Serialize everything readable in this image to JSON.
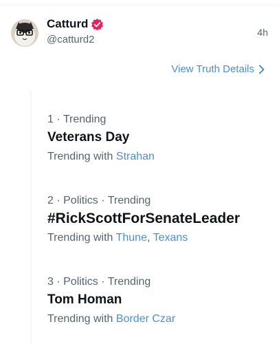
{
  "post": {
    "display_name": "Catturd",
    "handle": "@catturd2",
    "time": "4h",
    "view_details": "View Truth Details"
  },
  "trends": [
    {
      "meta": "1 · Trending",
      "title": "Veterans Day",
      "with_prefix": "Trending with",
      "links": [
        "Strahan"
      ]
    },
    {
      "meta": "2 · Politics · Trending",
      "title": "#RickScottForSenateLeader",
      "with_prefix": "Trending with",
      "links": [
        "Thune",
        "Texans"
      ],
      "separator": ", "
    },
    {
      "meta": "3 · Politics · Trending",
      "title": "Tom Homan",
      "with_prefix": "Trending with",
      "links": [
        "Border Czar"
      ]
    }
  ],
  "icons": {
    "verified": "verified-badge-icon",
    "chevron": "chevron-right-icon"
  },
  "colors": {
    "link": "#4a8fd1",
    "verified": "#e0245e",
    "muted": "#536471"
  }
}
